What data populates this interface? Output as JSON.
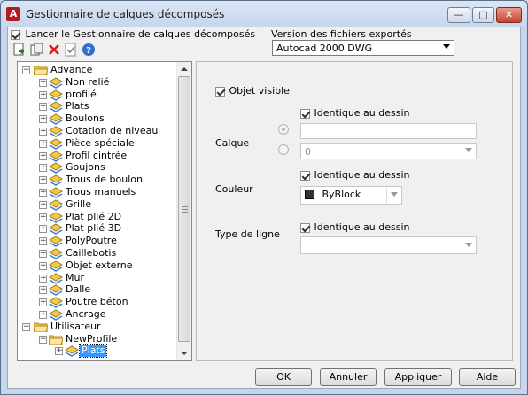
{
  "window": {
    "title": "Gestionnaire de calques décomposés",
    "app_icon": "A",
    "minimize_glyph": "—",
    "maximize_glyph": "□",
    "close_glyph": "✕"
  },
  "launch_checkbox": {
    "label": "Lancer le Gestionnaire de calques décomposés",
    "checked": true
  },
  "version": {
    "label": "Version des fichiers exportés",
    "value": "Autocad 2000 DWG"
  },
  "toolbar": {
    "icons": [
      "new-layer-icon",
      "copy-icon",
      "delete-icon",
      "properties-icon",
      "help-icon"
    ]
  },
  "tree": {
    "root_advance": "Advance",
    "advance_items": [
      "Non relié",
      "profilé",
      "Plats",
      "Boulons",
      "Cotation de niveau",
      "Pièce spéciale",
      "Profil cintrée",
      "Goujons",
      "Trous de boulon",
      "Trous manuels",
      "Grille",
      "Plat plié 2D",
      "Plat plié 3D",
      "PolyPoutre",
      "Caillebotis",
      "Objet externe",
      "Mur",
      "Dalle",
      "Poutre béton",
      "Ancrage"
    ],
    "root_user": "Utilisateur",
    "user_folder": "NewProfile",
    "user_item": "Plats"
  },
  "panel": {
    "visible": {
      "label": "Objet visible",
      "checked": true
    },
    "calque": {
      "label": "Calque",
      "same_as_drawing": "Identique au dessin",
      "text_value": "",
      "combo_value": "0"
    },
    "couleur": {
      "label": "Couleur",
      "same_as_drawing": "Identique au dessin",
      "value": "ByBlock",
      "swatch": "#333333"
    },
    "type_ligne": {
      "label": "Type de ligne",
      "same_as_drawing": "Identique au dessin",
      "value": ""
    }
  },
  "buttons": {
    "ok": "OK",
    "cancel": "Annuler",
    "apply": "Appliquer",
    "help": "Aide"
  },
  "colors": {
    "selection": "#3399ff",
    "folder": "#f2c94c",
    "layer": "#3a7bd5"
  }
}
